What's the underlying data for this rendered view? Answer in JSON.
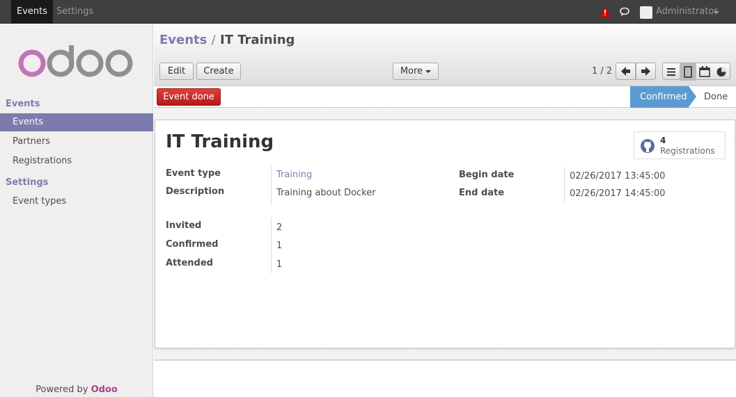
{
  "topbar": {
    "menus": [
      "Events",
      "Settings"
    ],
    "user": "Administrator",
    "icons": {
      "warning": "warning-icon",
      "chat": "chat-icon",
      "avatar": "avatar"
    },
    "warning_color": "#cc0000"
  },
  "sidebar": {
    "sections": [
      {
        "title": "Events",
        "items": [
          "Events",
          "Partners",
          "Registrations"
        ]
      },
      {
        "title": "Settings",
        "items": [
          "Event types"
        ]
      }
    ],
    "logo_text": "odoo",
    "powered_prefix": "Powered by",
    "powered_brand": "Odoo"
  },
  "control_panel": {
    "breadcrumb_parent": "Events",
    "breadcrumb_sep": "/",
    "breadcrumb_current": "IT Training",
    "edit_label": "Edit",
    "create_label": "Create",
    "more_label": "More",
    "pager": "1 / 2"
  },
  "statusbar": {
    "action_label": "Event done",
    "stages": [
      "Confirmed",
      "Done"
    ],
    "active_stage": "Confirmed"
  },
  "record": {
    "title": "IT Training",
    "smart_button": {
      "count": "4",
      "label": "Registrations"
    },
    "fields_left": [
      {
        "label": "Event type",
        "value": "Training"
      },
      {
        "label": "Description",
        "value": "Training about Docker"
      }
    ],
    "fields_right": [
      {
        "label": "Begin date",
        "value": "02/26/2017 13:45:00"
      },
      {
        "label": "End date",
        "value": "02/26/2017 14:45:00"
      }
    ],
    "counts": [
      {
        "label": "Invited",
        "value": "2"
      },
      {
        "label": "Confirmed",
        "value": "1"
      },
      {
        "label": "Attended",
        "value": "1"
      }
    ]
  },
  "colors": {
    "brand": "#7c7bad",
    "odoo": "#a24689",
    "stage": "#5c9bd1",
    "danger": "#c9302c"
  }
}
